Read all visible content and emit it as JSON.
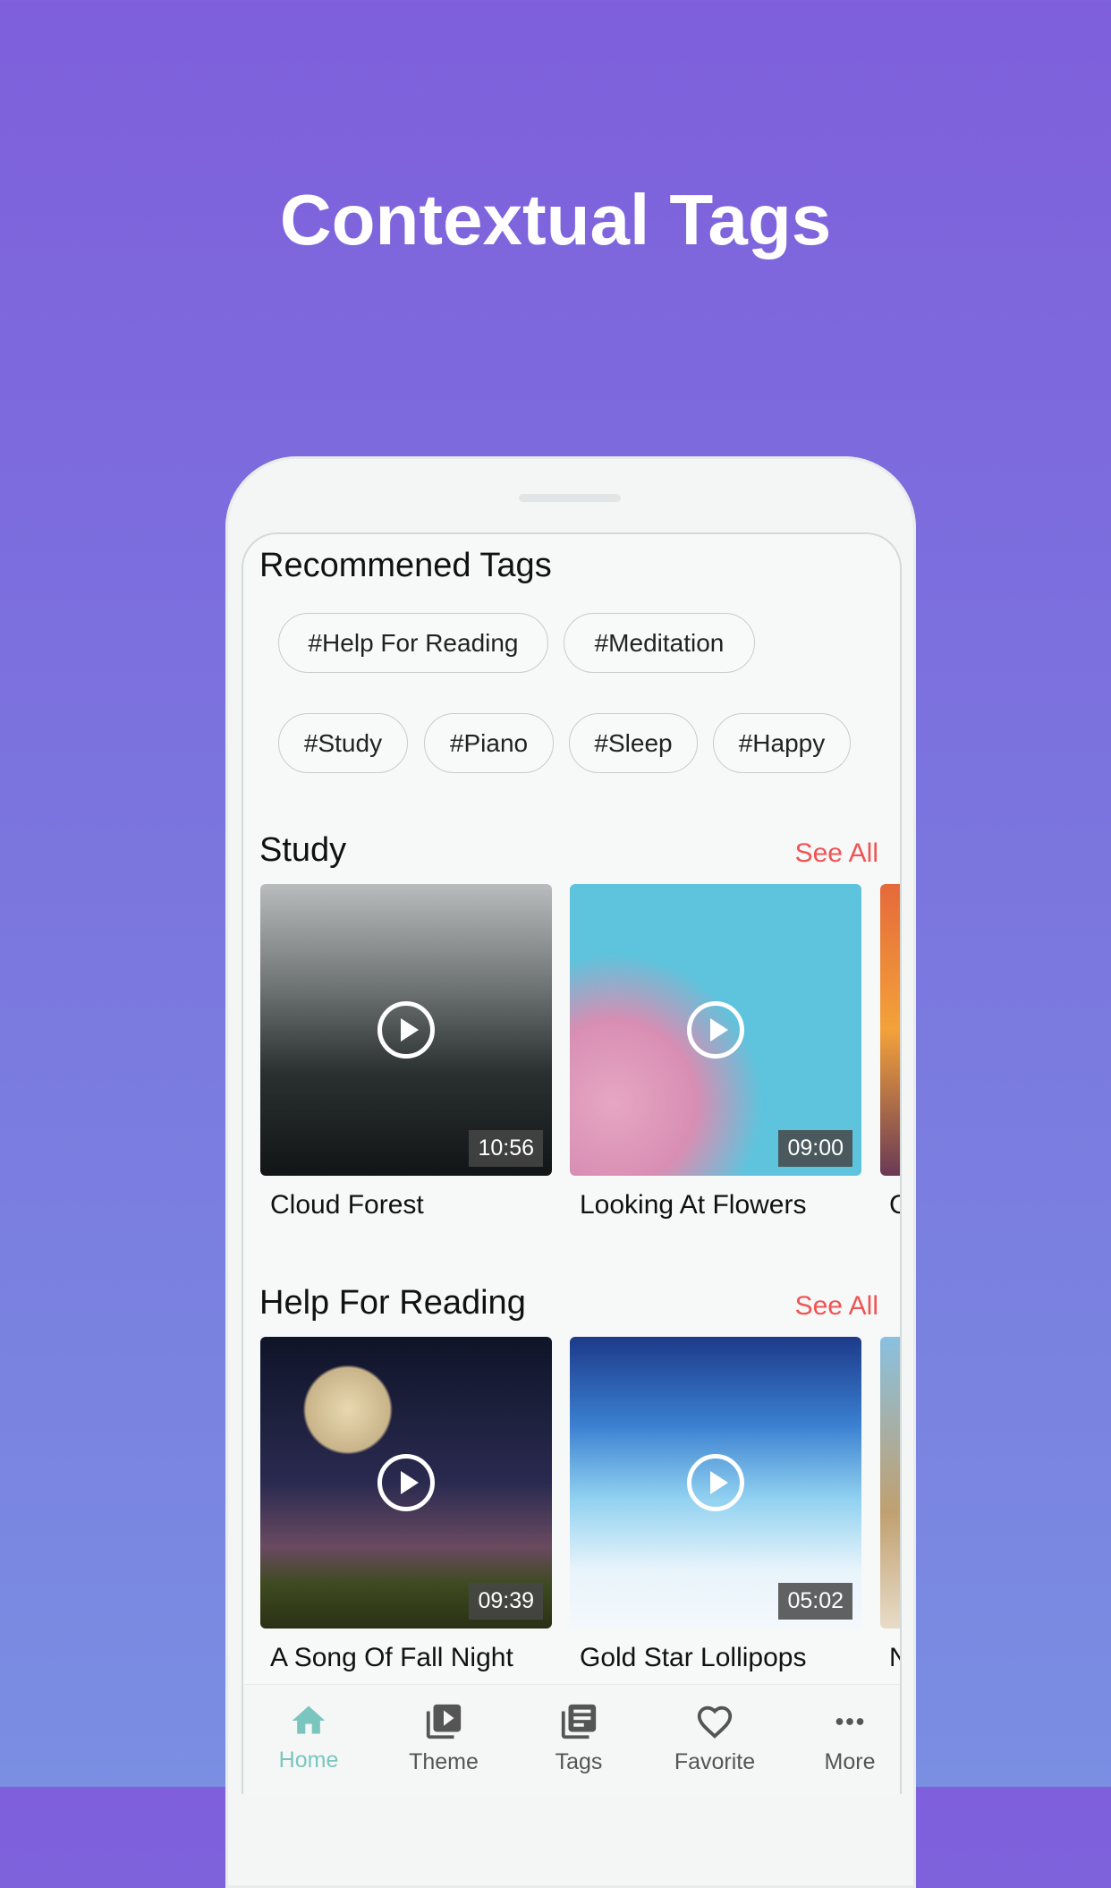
{
  "headline": "Contextual Tags",
  "recommended": {
    "title": "Recommened Tags",
    "tags": [
      "#Help For Reading",
      "#Meditation",
      "#Study",
      "#Piano",
      "#Sleep",
      "#Happy"
    ]
  },
  "sections": [
    {
      "title": "Study",
      "see_all": "See All",
      "items": [
        {
          "title": "Cloud Forest",
          "duration": "10:56"
        },
        {
          "title": "Looking At Flowers",
          "duration": "09:00"
        },
        {
          "title": "C"
        }
      ]
    },
    {
      "title": "Help For Reading",
      "see_all": "See All",
      "items": [
        {
          "title": "A Song Of Fall Night",
          "duration": "09:39"
        },
        {
          "title": "Gold Star Lollipops",
          "duration": "05:02"
        },
        {
          "title": "N"
        }
      ]
    }
  ],
  "nav": [
    {
      "label": "Home",
      "icon": "home-icon",
      "active": true
    },
    {
      "label": "Theme",
      "icon": "video-library-icon"
    },
    {
      "label": "Tags",
      "icon": "library-books-icon"
    },
    {
      "label": "Favorite",
      "icon": "heart-icon"
    },
    {
      "label": "More",
      "icon": "more-horizontal-icon"
    }
  ],
  "colors": {
    "accent": "#7ac6bf",
    "see_all": "#f05454"
  }
}
